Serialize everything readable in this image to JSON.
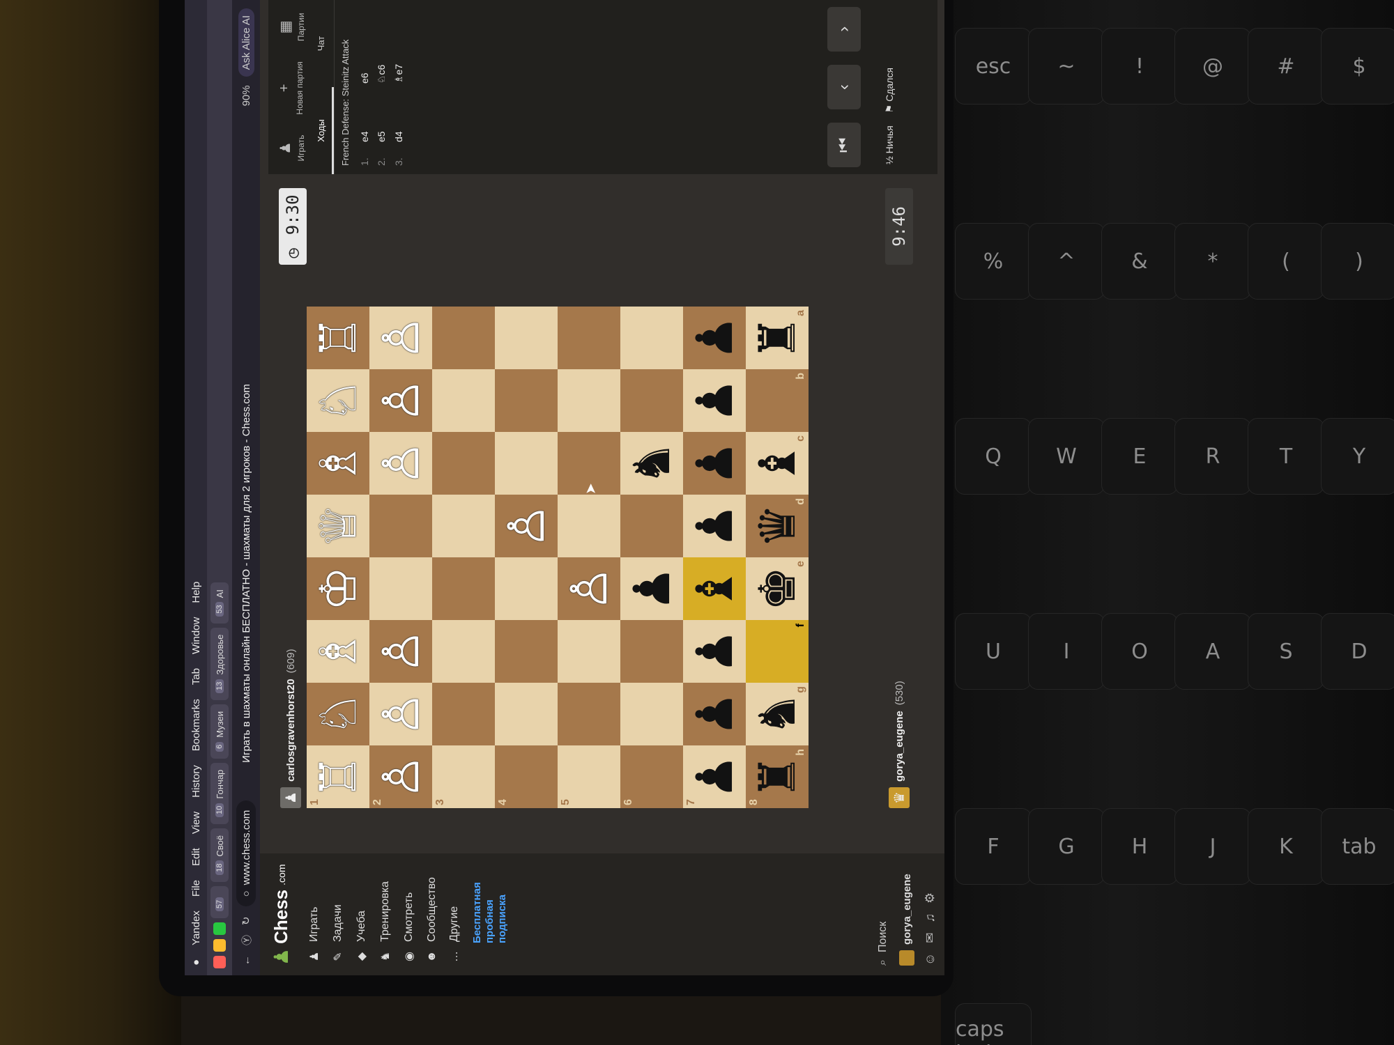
{
  "menu_bar": [
    "Yandex",
    "File",
    "Edit",
    "View",
    "History",
    "Bookmarks",
    "Tab",
    "Window",
    "Help"
  ],
  "tabs": [
    {
      "count": "57",
      "label": ""
    },
    {
      "count": "18",
      "label": "Своё"
    },
    {
      "count": "10",
      "label": "Гончар"
    },
    {
      "count": "6",
      "label": "Музеи"
    },
    {
      "count": "13",
      "label": "Здоровье"
    },
    {
      "count": "53",
      "label": "AI"
    }
  ],
  "address": {
    "url": "www.chess.com",
    "title": "Играть в шахматы онлайн БЕСПЛАТНО - шахматы для 2 игроков - Chess.com",
    "zoom": "90%",
    "alice": "Ask Alice AI"
  },
  "sidebar": {
    "logo": "Chess",
    "logo_suffix": ".com",
    "items": [
      {
        "label": "Играть",
        "icon": "♟"
      },
      {
        "label": "Задачи",
        "icon": "✎"
      },
      {
        "label": "Учеба",
        "icon": "◆"
      },
      {
        "label": "Тренировка",
        "icon": "♞"
      },
      {
        "label": "Смотреть",
        "icon": "◉"
      },
      {
        "label": "Сообщество",
        "icon": "☻"
      },
      {
        "label": "Другие",
        "icon": "…"
      }
    ],
    "promo": "Бесплатная пробная подписка",
    "search": "Поиск",
    "username": "gorya_eugene"
  },
  "game": {
    "top_player": {
      "name": "carlosgravenhorst20",
      "rating": "(609)"
    },
    "bottom_player": {
      "name": "gorya_eugene",
      "rating": "(530)"
    },
    "top_clock": "9:30",
    "bottom_clock": "9:46",
    "ranks": [
      "1",
      "2",
      "3",
      "4",
      "5",
      "6",
      "7",
      "8"
    ],
    "files": [
      "h",
      "g",
      "f",
      "e",
      "d",
      "c",
      "b",
      "a"
    ]
  },
  "panel": {
    "tabs": [
      {
        "label": "Играть",
        "icon": "♟"
      },
      {
        "label": "Новая партия",
        "icon": "+"
      },
      {
        "label": "Партии",
        "icon": "▦"
      }
    ],
    "subtabs": [
      "Ходы",
      "Чат"
    ],
    "opening": "French Defense: Steinitz Attack",
    "moves": [
      {
        "n": "1.",
        "w": "e4",
        "b": "e6"
      },
      {
        "n": "2.",
        "w": "e5",
        "b": "♘c6"
      },
      {
        "n": "3.",
        "w": "d4",
        "b": "♗e7"
      }
    ],
    "controls": [
      "⏮",
      "‹",
      "›"
    ],
    "draw": "½ Ничья",
    "resign": "⚑ Сдался"
  },
  "board_rows": [
    [
      {
        "p": "♖",
        "c": "w"
      },
      {
        "p": "♘",
        "c": "w"
      },
      {
        "p": "♗",
        "c": "w"
      },
      {
        "p": "♔",
        "c": "w"
      },
      {
        "p": "♕",
        "c": "w"
      },
      {
        "p": "♗",
        "c": "w"
      },
      {
        "p": "♘",
        "c": "w"
      },
      {
        "p": "♖",
        "c": "w"
      }
    ],
    [
      {
        "p": "♙",
        "c": "w"
      },
      {
        "p": "♙",
        "c": "w"
      },
      {
        "p": "♙",
        "c": "w"
      },
      {
        "p": "",
        "c": ""
      },
      {
        "p": "",
        "c": ""
      },
      {
        "p": "♙",
        "c": "w"
      },
      {
        "p": "♙",
        "c": "w"
      },
      {
        "p": "♙",
        "c": "w"
      }
    ],
    [
      {
        "p": "",
        "c": ""
      },
      {
        "p": "",
        "c": ""
      },
      {
        "p": "",
        "c": ""
      },
      {
        "p": "",
        "c": ""
      },
      {
        "p": "",
        "c": ""
      },
      {
        "p": "",
        "c": ""
      },
      {
        "p": "",
        "c": ""
      },
      {
        "p": "",
        "c": ""
      }
    ],
    [
      {
        "p": "",
        "c": ""
      },
      {
        "p": "",
        "c": ""
      },
      {
        "p": "",
        "c": ""
      },
      {
        "p": "",
        "c": ""
      },
      {
        "p": "♙",
        "c": "w"
      },
      {
        "p": "",
        "c": ""
      },
      {
        "p": "",
        "c": ""
      },
      {
        "p": "",
        "c": ""
      }
    ],
    [
      {
        "p": "",
        "c": ""
      },
      {
        "p": "",
        "c": ""
      },
      {
        "p": "",
        "c": ""
      },
      {
        "p": "♙",
        "c": "w"
      },
      {
        "p": "",
        "c": ""
      },
      {
        "p": "",
        "c": ""
      },
      {
        "p": "",
        "c": ""
      },
      {
        "p": "",
        "c": ""
      }
    ],
    [
      {
        "p": "",
        "c": ""
      },
      {
        "p": "",
        "c": ""
      },
      {
        "p": "",
        "c": ""
      },
      {
        "p": "♟",
        "c": "b"
      },
      {
        "p": "",
        "c": ""
      },
      {
        "p": "♞",
        "c": "b"
      },
      {
        "p": "",
        "c": ""
      },
      {
        "p": "",
        "c": ""
      }
    ],
    [
      {
        "p": "♟",
        "c": "b"
      },
      {
        "p": "♟",
        "c": "b"
      },
      {
        "p": "♟",
        "c": "b"
      },
      {
        "p": "♝",
        "c": "b",
        "hl": true
      },
      {
        "p": "♟",
        "c": "b"
      },
      {
        "p": "♟",
        "c": "b"
      },
      {
        "p": "♟",
        "c": "b"
      },
      {
        "p": "♟",
        "c": "b"
      }
    ],
    [
      {
        "p": "♜",
        "c": "b"
      },
      {
        "p": "♞",
        "c": "b"
      },
      {
        "p": "",
        "c": "",
        "hl": true
      },
      {
        "p": "♚",
        "c": "b"
      },
      {
        "p": "♛",
        "c": "b"
      },
      {
        "p": "♝",
        "c": "b"
      },
      {
        "p": "",
        "c": ""
      },
      {
        "p": "♜",
        "c": "b"
      }
    ]
  ],
  "keyboard": [
    "esc",
    "~",
    "!",
    "@",
    "#",
    "$",
    "%",
    "^",
    "&",
    "*",
    "(",
    ")",
    "Q",
    "W",
    "E",
    "R",
    "T",
    "Y",
    "U",
    "I",
    "O",
    "A",
    "S",
    "D",
    "F",
    "G",
    "H",
    "J",
    "K",
    "tab",
    "caps lock"
  ]
}
